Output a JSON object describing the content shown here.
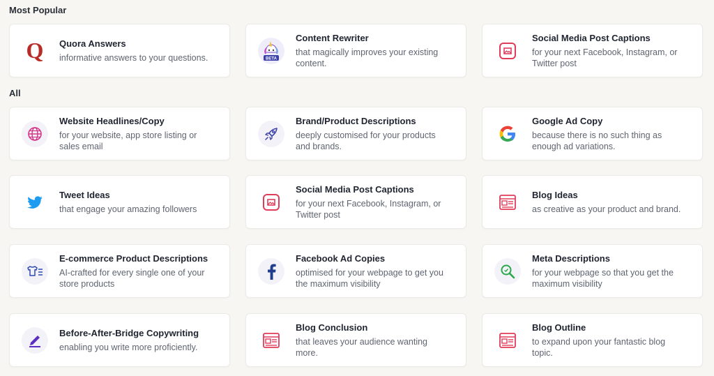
{
  "sections": {
    "most_popular": "Most Popular",
    "all": "All"
  },
  "colors": {
    "quora_red": "#b92b27",
    "brand_accent": "#e03c5a",
    "twitter_blue": "#1d9bf0",
    "facebook_blue": "#1f3d8a",
    "purple": "#5a2fc2",
    "green": "#2aa84a"
  },
  "cards": [
    {
      "icon": "quora-q-icon",
      "title": "Quora Answers",
      "desc": "informative answers to your questions."
    },
    {
      "icon": "unicorn-beta-icon",
      "badge": "BETA",
      "title": "Content Rewriter",
      "desc": "that magically improves your existing content."
    },
    {
      "icon": "image-frame-icon",
      "title": "Social Media Post Captions",
      "desc": "for your next Facebook, Instagram, or Twitter post"
    },
    {
      "icon": "globe-icon",
      "title": "Website Headlines/Copy",
      "desc": "for your website, app store listing or sales email"
    },
    {
      "icon": "rocket-icon",
      "title": "Brand/Product Descriptions",
      "desc": "deeply customised for your products and brands."
    },
    {
      "icon": "google-g-icon",
      "title": "Google Ad Copy",
      "desc": "because there is no such thing as enough ad variations."
    },
    {
      "icon": "twitter-bird-icon",
      "title": "Tweet Ideas",
      "desc": "that engage your amazing followers"
    },
    {
      "icon": "image-frame-icon",
      "title": "Social Media Post Captions",
      "desc": "for your next Facebook, Instagram, or Twitter post"
    },
    {
      "icon": "newspaper-icon",
      "title": "Blog Ideas",
      "desc": "as creative as your product and brand."
    },
    {
      "icon": "tshirt-list-icon",
      "title": "E-commerce Product Descriptions",
      "desc": "AI-crafted for every single one of your store products"
    },
    {
      "icon": "facebook-f-icon",
      "title": "Facebook Ad Copies",
      "desc": "optimised for your webpage to get you the maximum visibility"
    },
    {
      "icon": "magnifier-icon",
      "title": "Meta Descriptions",
      "desc": "for your webpage so that you get the maximum visibility"
    },
    {
      "icon": "pen-underline-icon",
      "title": "Before-After-Bridge Copywriting",
      "desc": "enabling you write more proficiently."
    },
    {
      "icon": "newspaper-icon",
      "title": "Blog Conclusion",
      "desc": "that leaves your audience wanting more."
    },
    {
      "icon": "newspaper-icon",
      "title": "Blog Outline",
      "desc": "to expand upon your fantastic blog topic."
    }
  ]
}
